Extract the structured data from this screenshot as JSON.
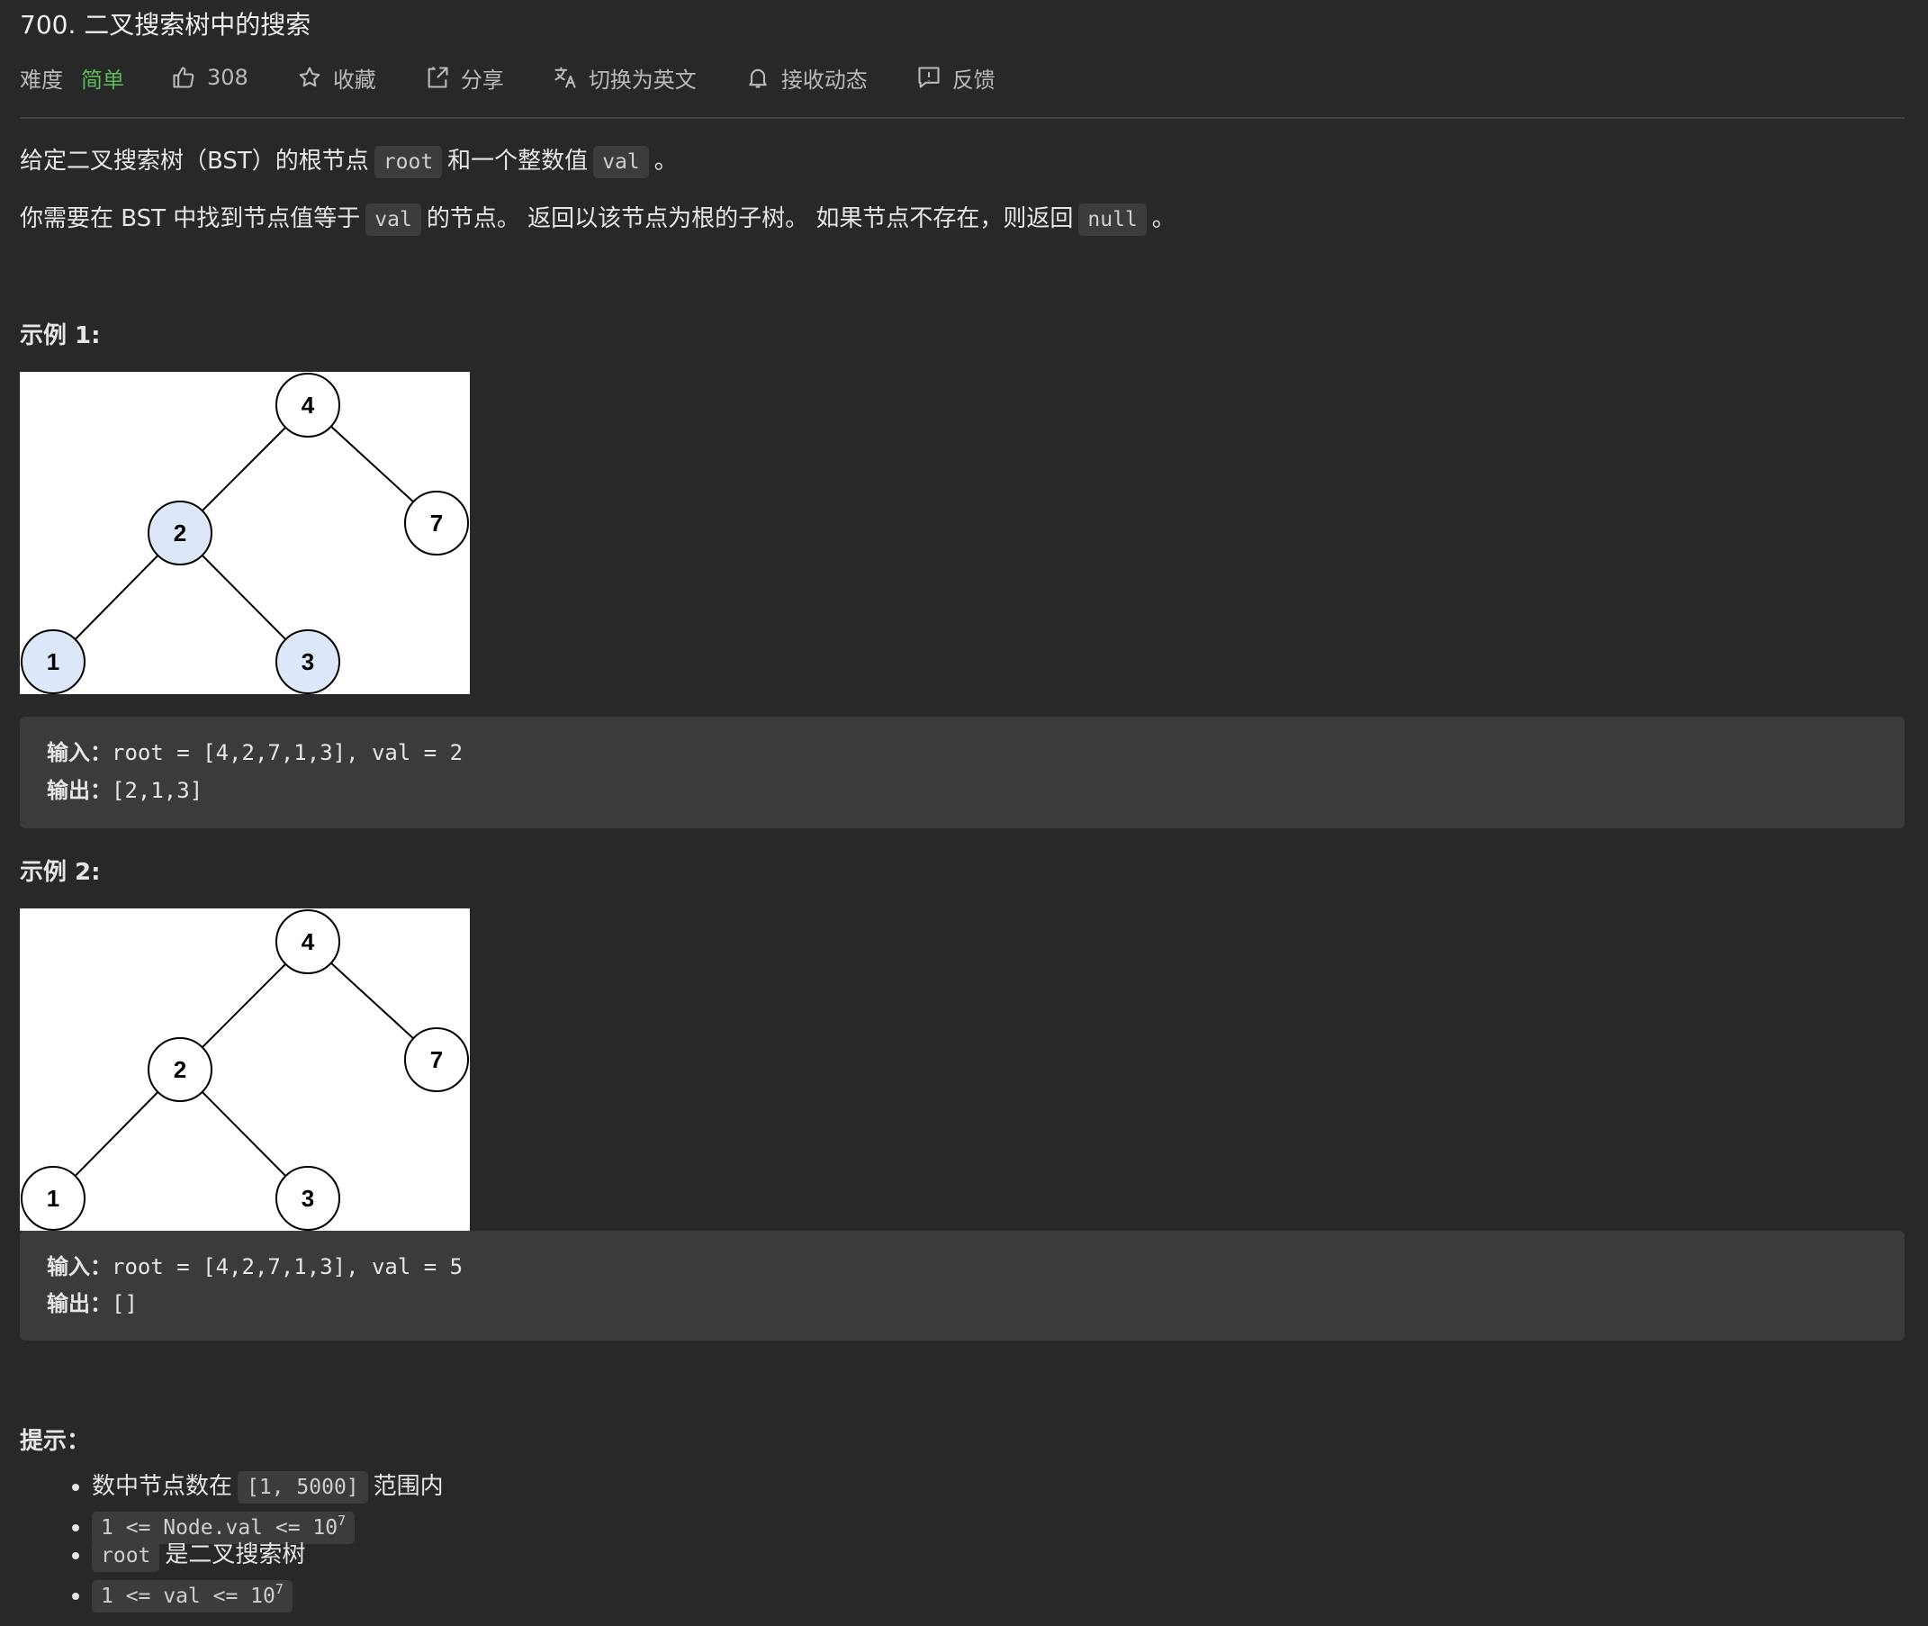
{
  "problem": {
    "title": "700. 二叉搜索树中的搜索"
  },
  "toolbar": {
    "difficulty_label": "难度",
    "difficulty_value": "简单",
    "likes": "308",
    "favorite": "收藏",
    "share": "分享",
    "translate": "切换为英文",
    "subscribe": "接收动态",
    "feedback": "反馈"
  },
  "description": {
    "p1": {
      "a": "给定二叉搜索树（BST）的根节点",
      "code1": "root",
      "b": "和一个整数值",
      "code2": "val",
      "c": "。"
    },
    "p2": {
      "a": "你需要在 BST 中找到节点值等于",
      "code1": "val",
      "b": "的节点。 返回以该节点为根的子树。 如果节点不存在，则返回",
      "code2": "null",
      "c": "。"
    }
  },
  "examples": [
    {
      "heading": "示例 1:",
      "tree_nodes": [
        "4",
        "2",
        "7",
        "1",
        "3"
      ],
      "highlighted_nodes": [
        "2",
        "1",
        "3"
      ],
      "input_label": "输入：",
      "input_value": "root = [4,2,7,1,3], val = 2",
      "output_label": "输出：",
      "output_value": "[2,1,3]"
    },
    {
      "heading": "示例 2:",
      "tree_nodes": [
        "4",
        "2",
        "7",
        "1",
        "3"
      ],
      "highlighted_nodes": [],
      "input_label": "输入：",
      "input_value": "root = [4,2,7,1,3], val = 5",
      "output_label": "输出：",
      "output_value": "[]"
    }
  ],
  "hints": {
    "heading": "提示：",
    "h1": {
      "a": "数中节点数在",
      "code": "[1, 5000]",
      "b": "范围内"
    },
    "h2": {
      "code": "1 <= Node.val <= 10",
      "sup": "7"
    },
    "h3": {
      "code": "root",
      "b": "是二叉搜索树"
    },
    "h4": {
      "code": "1 <= val <= 10",
      "sup": "7"
    }
  },
  "colors": {
    "background": "#282828",
    "easy": "#5cb85c",
    "node_highlight": "#dce8fa"
  }
}
